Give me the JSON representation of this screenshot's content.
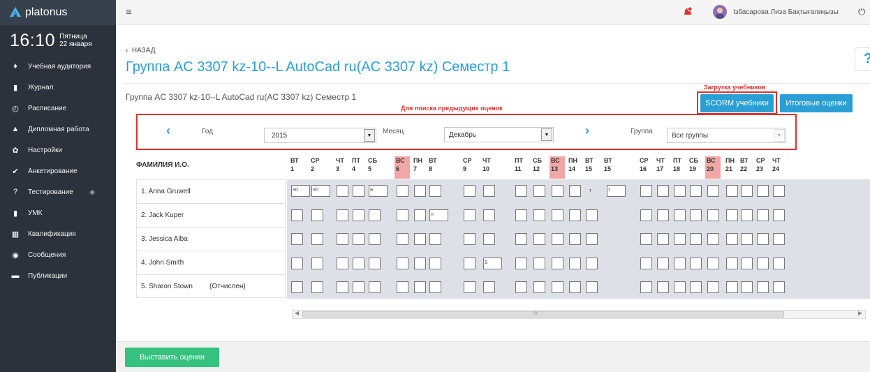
{
  "app": {
    "name": "platonus"
  },
  "clock": {
    "time": "16:10",
    "weekday": "Пятница",
    "date": "22 января"
  },
  "sidebar": {
    "items": [
      {
        "label": "Учебная аудитория",
        "icon": "classroom-icon"
      },
      {
        "label": "Журнал",
        "icon": "journal-icon"
      },
      {
        "label": "Расписание",
        "icon": "clock-icon"
      },
      {
        "label": "Дипломная работа",
        "icon": "graduation-cap-icon"
      },
      {
        "label": "Настройки",
        "icon": "wrench-icon"
      },
      {
        "label": "Анкетирование",
        "icon": "check-circle-icon"
      },
      {
        "label": "Тестирование",
        "icon": "question-circle-icon"
      },
      {
        "label": "УМК",
        "icon": "book-icon"
      },
      {
        "label": "Квалификация",
        "icon": "certificate-icon"
      },
      {
        "label": "Сообщения",
        "icon": "chat-icon"
      },
      {
        "label": "Публикации",
        "icon": "folder-icon"
      }
    ]
  },
  "header": {
    "user_name": "Ізбасарова Лиза Бақтығалиқызы"
  },
  "nav": {
    "back_label": "НАЗАД"
  },
  "page": {
    "title": "Группа AC 3307 kz-10--L AutoCad ru(AC 3307 kz) Семестр 1",
    "panel_title": "Группа AC 3307 kz-10--L AutoCad ru(AC 3307 kz) Семестр 1",
    "note_search": "Для поиска предыдущих оценок",
    "note_upload": "Загрузка учебников",
    "help": "?"
  },
  "buttons": {
    "scorm": "SCORM учебники",
    "final_grades": "Итоговые оценки",
    "set_grades": "Выставить оценки"
  },
  "filters": {
    "year_label": "Год",
    "year_value": "2015",
    "year_select": "2015",
    "month_label": "Месяц",
    "month_value": "Декабрь",
    "group_label": "Группа",
    "group_value": "Все группы"
  },
  "grid": {
    "name_header": "ФАМИЛИЯ И.О.",
    "days": [
      {
        "dow": "ВТ",
        "num": "1",
        "weekend": false
      },
      {
        "dow": "СР",
        "num": "2",
        "weekend": false
      },
      {
        "dow": "ЧТ",
        "num": "3",
        "weekend": false
      },
      {
        "dow": "ПТ",
        "num": "4",
        "weekend": false
      },
      {
        "dow": "СБ",
        "num": "5",
        "weekend": false
      },
      {
        "dow": "ВС",
        "num": "6",
        "weekend": true
      },
      {
        "dow": "ПН",
        "num": "7",
        "weekend": false
      },
      {
        "dow": "ВТ",
        "num": "8",
        "weekend": false
      },
      {
        "dow": "СР",
        "num": "9",
        "weekend": false
      },
      {
        "dow": "ЧТ",
        "num": "10",
        "weekend": false
      },
      {
        "dow": "ПТ",
        "num": "11",
        "weekend": false
      },
      {
        "dow": "СБ",
        "num": "12",
        "weekend": false
      },
      {
        "dow": "ВС",
        "num": "13",
        "weekend": true
      },
      {
        "dow": "ПН",
        "num": "14",
        "weekend": false
      },
      {
        "dow": "ВТ",
        "num": "15",
        "weekend": false
      },
      {
        "dow": "ВТ",
        "num": "15",
        "weekend": false
      },
      {
        "dow": "СР",
        "num": "16",
        "weekend": false
      },
      {
        "dow": "ЧТ",
        "num": "17",
        "weekend": false
      },
      {
        "dow": "ПТ",
        "num": "18",
        "weekend": false
      },
      {
        "dow": "СБ",
        "num": "19",
        "weekend": false
      },
      {
        "dow": "ВС",
        "num": "20",
        "weekend": true
      },
      {
        "dow": "ПН",
        "num": "21",
        "weekend": false
      },
      {
        "dow": "ВТ",
        "num": "22",
        "weekend": false
      },
      {
        "dow": "СР",
        "num": "23",
        "weekend": false
      },
      {
        "dow": "ЧТ",
        "num": "24",
        "weekend": false
      }
    ],
    "students": [
      {
        "name": "1. Anna Gruwell",
        "extra": "",
        "marks": [
          "90",
          "90",
          "",
          "",
          "Б",
          "",
          "",
          "",
          "",
          "",
          "",
          "",
          "",
          "",
          "т",
          "т",
          "",
          "",
          "",
          "",
          "",
          "",
          "",
          "",
          ""
        ]
      },
      {
        "name": "2. Jack Kuper",
        "extra": "",
        "marks": [
          "",
          "",
          "",
          "",
          "",
          "",
          "",
          "н",
          "",
          "",
          "",
          "",
          "",
          "",
          "",
          "",
          "",
          "",
          "",
          "",
          "",
          "",
          "",
          "",
          ""
        ]
      },
      {
        "name": "3. Jessica Alba",
        "extra": "",
        "marks": [
          "",
          "",
          "",
          "",
          "",
          "",
          "",
          "",
          "",
          "",
          "",
          "",
          "",
          "",
          "",
          "",
          "",
          "",
          "",
          "",
          "",
          "",
          "",
          "",
          ""
        ]
      },
      {
        "name": "4. John Smith",
        "extra": "",
        "marks": [
          "",
          "",
          "",
          "",
          "",
          "",
          "",
          "",
          "",
          "Б",
          "",
          "",
          "",
          "",
          "",
          "",
          "",
          "",
          "",
          "",
          "",
          "",
          "",
          "",
          ""
        ]
      },
      {
        "name": "5. Sharon Stown",
        "extra": "(Отчислен)",
        "marks": [
          "",
          "",
          "",
          "",
          "",
          "",
          "",
          "",
          "",
          "",
          "",
          "",
          "",
          "",
          "",
          "",
          "",
          "",
          "",
          "",
          "",
          "",
          "",
          "",
          ""
        ]
      }
    ]
  },
  "scrollbar": {
    "grip": "III"
  }
}
